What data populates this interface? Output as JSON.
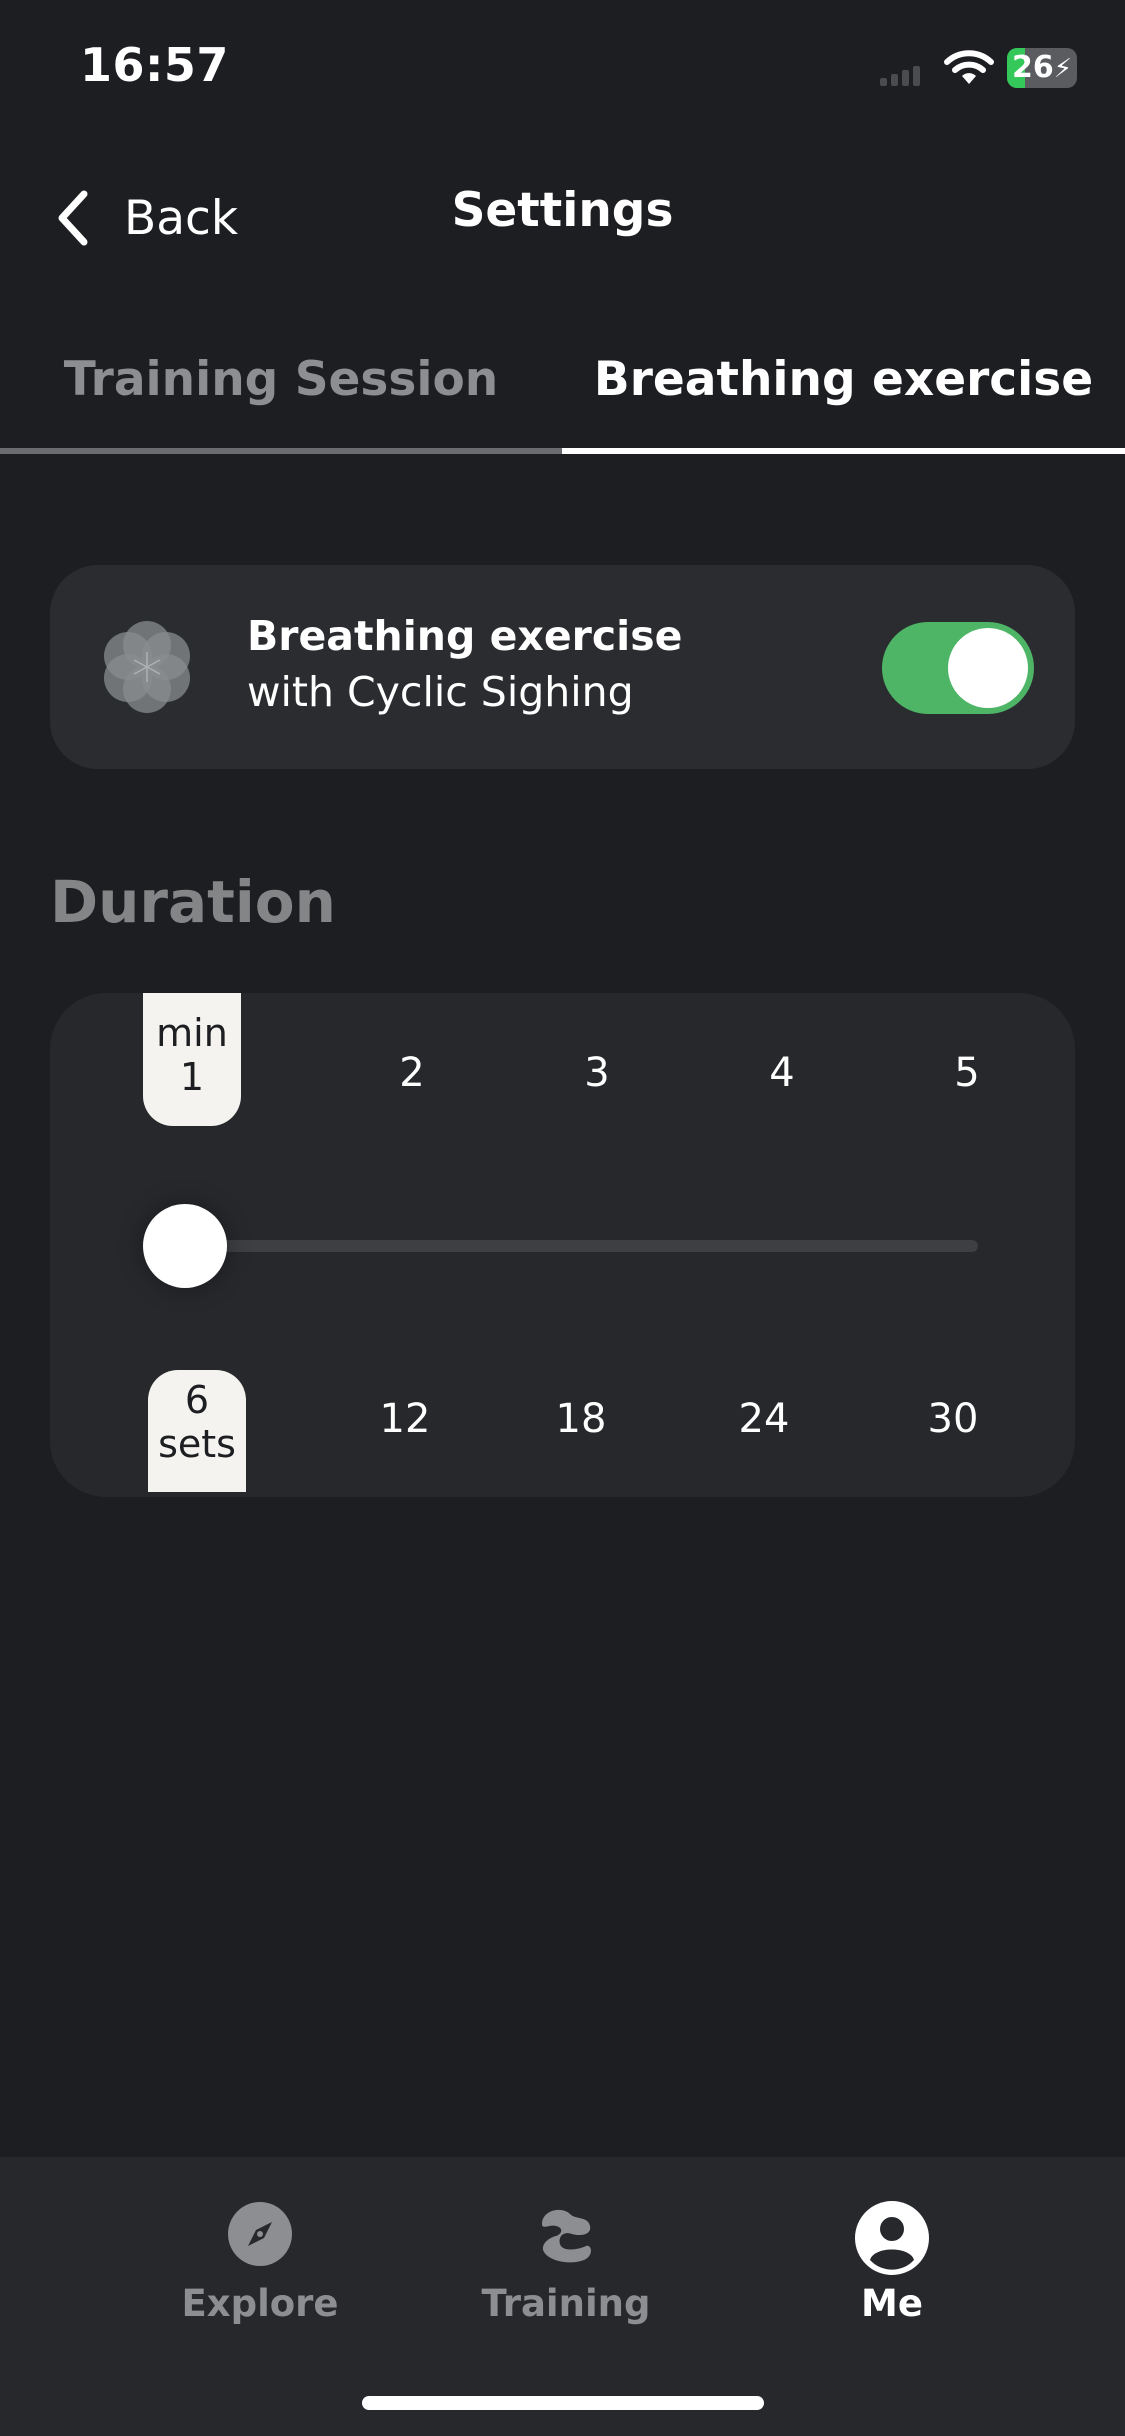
{
  "status_bar": {
    "time": "16:57",
    "battery_percent": "26",
    "battery_level": 0.26,
    "battery_color": "#34c759",
    "icons": [
      "signal-icon",
      "wifi-icon",
      "battery-charging-icon"
    ]
  },
  "nav": {
    "back_label": "Back",
    "title": "Settings",
    "back_icon": "chevron-left-icon"
  },
  "tabs": [
    {
      "label": "Training Session",
      "active": false
    },
    {
      "label": "Breathing exercise",
      "active": true
    }
  ],
  "breathing_card": {
    "icon": "flower-icon",
    "title": "Breathing exercise",
    "subtitle": "with Cyclic Sighing",
    "toggle_on": true,
    "toggle_color": "#4eb567"
  },
  "duration": {
    "label": "Duration",
    "minutes": {
      "unit": "min",
      "selected": "1",
      "options": [
        "2",
        "3",
        "4",
        "5"
      ]
    },
    "sets": {
      "unit": "sets",
      "selected": "6",
      "options": [
        "12",
        "18",
        "24",
        "30"
      ]
    },
    "slider_position": 0
  },
  "tab_bar": {
    "items": [
      {
        "label": "Explore",
        "icon": "compass-icon",
        "active": false
      },
      {
        "label": "Training",
        "icon": "training-icon",
        "active": false
      },
      {
        "label": "Me",
        "icon": "profile-icon",
        "active": true
      }
    ]
  }
}
